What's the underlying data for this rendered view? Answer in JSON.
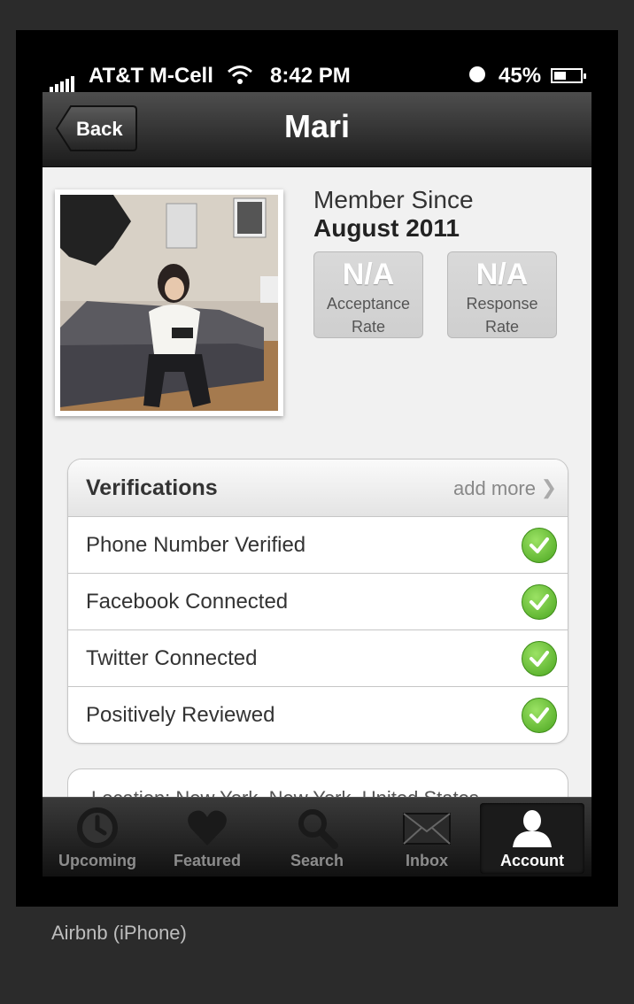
{
  "status": {
    "carrier": "AT&T M-Cell",
    "time": "8:42 PM",
    "battery": "45%",
    "battery_level": 0.45
  },
  "nav": {
    "back_label": "Back",
    "title": "Mari"
  },
  "profile": {
    "member_since_label": "Member Since",
    "member_since_date": "August 2011",
    "stats": [
      {
        "value": "N/A",
        "line1": "Acceptance",
        "line2": "Rate"
      },
      {
        "value": "N/A",
        "line1": "Response",
        "line2": "Rate"
      }
    ]
  },
  "verifications": {
    "title": "Verifications",
    "add_more": "add more",
    "items": [
      "Phone Number Verified",
      "Facebook Connected",
      "Twitter Connected",
      "Positively Reviewed"
    ]
  },
  "location": {
    "text": "Location: New York, New York, United States"
  },
  "tabs": [
    {
      "label": "Upcoming",
      "icon": "clock-icon"
    },
    {
      "label": "Featured",
      "icon": "heart-icon"
    },
    {
      "label": "Search",
      "icon": "magnifier-icon"
    },
    {
      "label": "Inbox",
      "icon": "envelope-icon"
    },
    {
      "label": "Account",
      "icon": "person-icon",
      "active": true
    }
  ],
  "caption": "Airbnb (iPhone)",
  "colors": {
    "check_green": "#5cbf2a",
    "navbar": "#2a2a2a"
  }
}
